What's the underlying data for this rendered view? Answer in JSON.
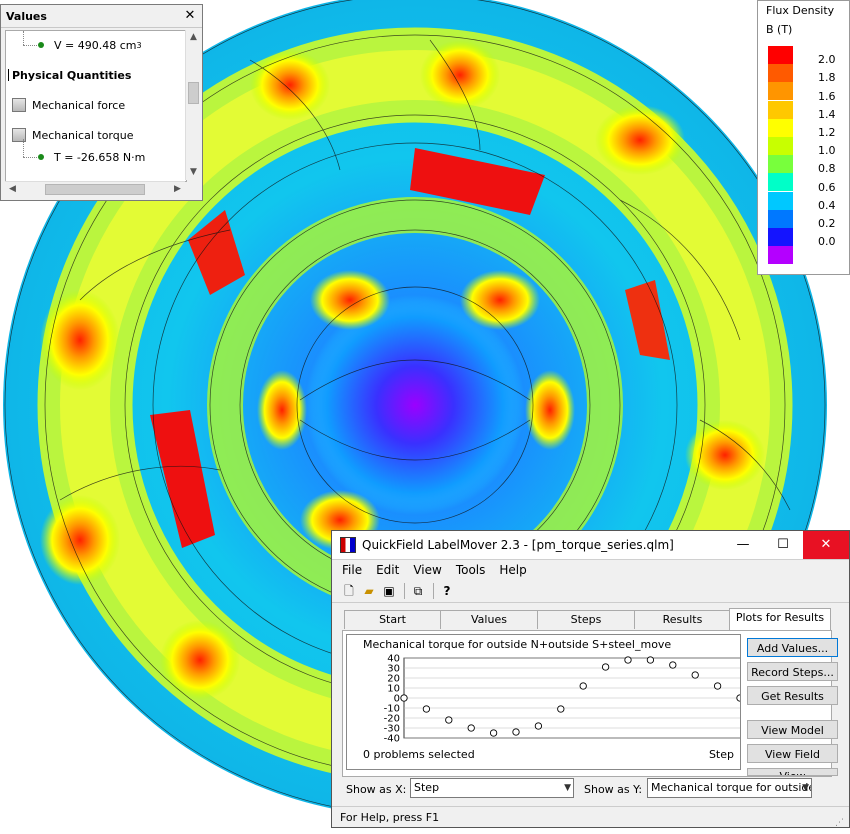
{
  "values_window": {
    "title": "Values",
    "close_symbol": "✕",
    "volume_label": "V = 490.48 cm",
    "volume_sup": "3",
    "section_label": "Physical Quantities",
    "items": [
      "Mechanical force",
      "Mechanical torque"
    ],
    "torque_value": "T = -26.658 N·m"
  },
  "legend": {
    "title": "Flux Density",
    "unit": "B (T)",
    "levels": [
      "2.0",
      "1.8",
      "1.6",
      "1.4",
      "1.2",
      "1.0",
      "0.8",
      "0.6",
      "0.4",
      "0.2",
      "0.0"
    ],
    "colors": [
      "#ff0000",
      "#ff5a00",
      "#ff9500",
      "#ffc800",
      "#ffff00",
      "#c8ff00",
      "#78ff3c",
      "#00ffc8",
      "#00c8ff",
      "#0078ff",
      "#1414ff",
      "#b400ff"
    ]
  },
  "labelmover": {
    "title": "QuickField LabelMover 2.3 - [pm_torque_series.qlm]",
    "window_buttons": {
      "minimize": "—",
      "maximize": "☐",
      "close": "✕"
    },
    "menu": [
      "File",
      "Edit",
      "View",
      "Tools",
      "Help"
    ],
    "toolbar_icons": [
      "new-file-icon",
      "open-folder-icon",
      "save-icon",
      "copy-icon",
      "help-icon"
    ],
    "tabs": [
      "Start",
      "Values",
      "Steps",
      "Results",
      "Plots for Results"
    ],
    "active_tab": "Plots for Results",
    "buttons": [
      "Add Values...",
      "Record Steps...",
      "Get Results",
      "View Model",
      "View Field",
      "View Contours..."
    ],
    "show_x_label": "Show as X:",
    "show_x_value": "Step",
    "show_y_label": "Show as Y:",
    "show_y_value": "Mechanical torque for outside",
    "status": "For Help, press F1",
    "plot_status": "0 problems selected"
  },
  "chart_data": {
    "type": "scatter",
    "title": "Mechanical torque for outside N+outside S+steel_move",
    "xlabel": "Step",
    "ylabel": "",
    "ylim": [
      -40,
      40
    ],
    "yticks": [
      40,
      30,
      20,
      10,
      0,
      -10,
      -20,
      -30,
      -40
    ],
    "x": [
      0,
      1,
      2,
      3,
      4,
      5,
      6,
      7,
      8,
      9,
      10,
      11,
      12,
      13,
      14,
      15
    ],
    "y": [
      0,
      -11,
      -22,
      -30,
      -35,
      -34,
      -28,
      -11,
      12,
      31,
      38,
      38,
      33,
      23,
      12,
      0
    ],
    "grid": true
  }
}
